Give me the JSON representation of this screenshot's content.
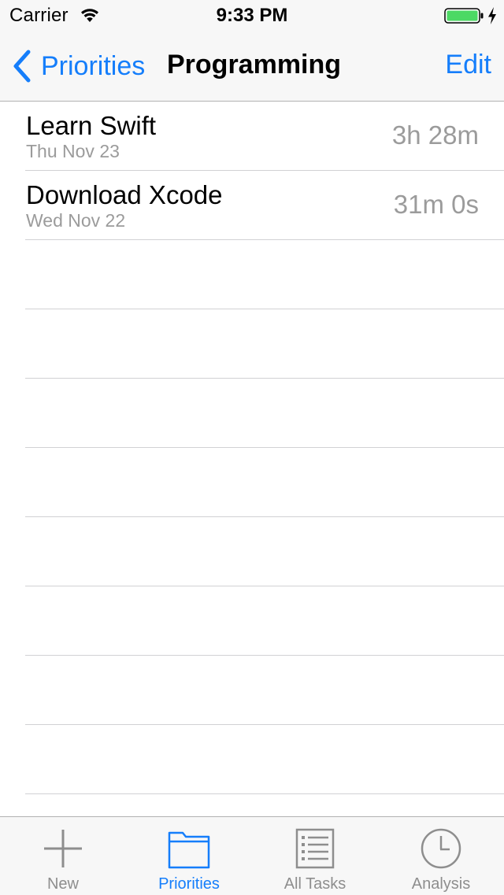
{
  "status_bar": {
    "carrier": "Carrier",
    "time": "9:33 PM",
    "icons": [
      "wifi-icon",
      "battery-icon",
      "charging-bolt-icon"
    ]
  },
  "nav": {
    "back_label": "Priorities",
    "title": "Programming",
    "edit_label": "Edit"
  },
  "tasks": [
    {
      "title": "Learn Swift",
      "date": "Thu Nov 23",
      "duration": "3h 28m"
    },
    {
      "title": "Download Xcode",
      "date": "Wed Nov 22",
      "duration": "31m 0s"
    }
  ],
  "tabs": [
    {
      "label": "New",
      "icon": "plus-icon",
      "active": false
    },
    {
      "label": "Priorities",
      "icon": "folder-icon",
      "active": true
    },
    {
      "label": "All Tasks",
      "icon": "list-icon",
      "active": false
    },
    {
      "label": "Analysis",
      "icon": "clock-icon",
      "active": false
    }
  ],
  "colors": {
    "tint": "#157efb",
    "secondary_text": "#9b9b9b",
    "bar_background": "#f7f7f7",
    "separator": "#d1d1d4",
    "battery_fill": "#4cd964"
  }
}
